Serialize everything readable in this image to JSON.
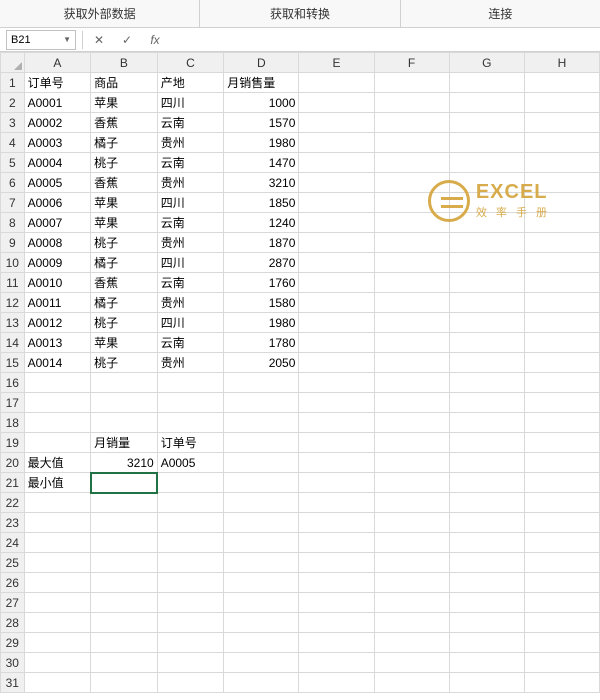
{
  "ribbon": {
    "tabs": [
      "获取外部数据",
      "获取和转换",
      "连接"
    ]
  },
  "nameBox": {
    "value": "B21"
  },
  "formulaBar": {
    "cancel": "✕",
    "confirm": "✓",
    "fx": "fx",
    "value": ""
  },
  "columns": [
    "A",
    "B",
    "C",
    "D",
    "E",
    "F",
    "G",
    "H"
  ],
  "rowCount": 31,
  "selectedCell": {
    "row": 21,
    "col": "B"
  },
  "cells": {
    "1": {
      "A": "订单号",
      "B": "商品",
      "C": "产地",
      "D": "月销售量"
    },
    "2": {
      "A": "A0001",
      "B": "苹果",
      "C": "四川",
      "D": 1000
    },
    "3": {
      "A": "A0002",
      "B": "香蕉",
      "C": "云南",
      "D": 1570
    },
    "4": {
      "A": "A0003",
      "B": "橘子",
      "C": "贵州",
      "D": 1980
    },
    "5": {
      "A": "A0004",
      "B": "桃子",
      "C": "云南",
      "D": 1470
    },
    "6": {
      "A": "A0005",
      "B": "香蕉",
      "C": "贵州",
      "D": 3210
    },
    "7": {
      "A": "A0006",
      "B": "苹果",
      "C": "四川",
      "D": 1850
    },
    "8": {
      "A": "A0007",
      "B": "苹果",
      "C": "云南",
      "D": 1240
    },
    "9": {
      "A": "A0008",
      "B": "桃子",
      "C": "贵州",
      "D": 1870
    },
    "10": {
      "A": "A0009",
      "B": "橘子",
      "C": "四川",
      "D": 2870
    },
    "11": {
      "A": "A0010",
      "B": "香蕉",
      "C": "云南",
      "D": 1760
    },
    "12": {
      "A": "A0011",
      "B": "橘子",
      "C": "贵州",
      "D": 1580
    },
    "13": {
      "A": "A0012",
      "B": "桃子",
      "C": "四川",
      "D": 1980
    },
    "14": {
      "A": "A0013",
      "B": "苹果",
      "C": "云南",
      "D": 1780
    },
    "15": {
      "A": "A0014",
      "B": "桃子",
      "C": "贵州",
      "D": 2050
    },
    "19": {
      "B": "月销量",
      "C": "订单号"
    },
    "20": {
      "A": "最大值",
      "B": 3210,
      "C": "A0005"
    },
    "21": {
      "A": "最小值"
    }
  },
  "numericColumns": [
    "D"
  ],
  "watermark": {
    "title": "EXCEL",
    "subtitle": "效 率 手 册"
  }
}
